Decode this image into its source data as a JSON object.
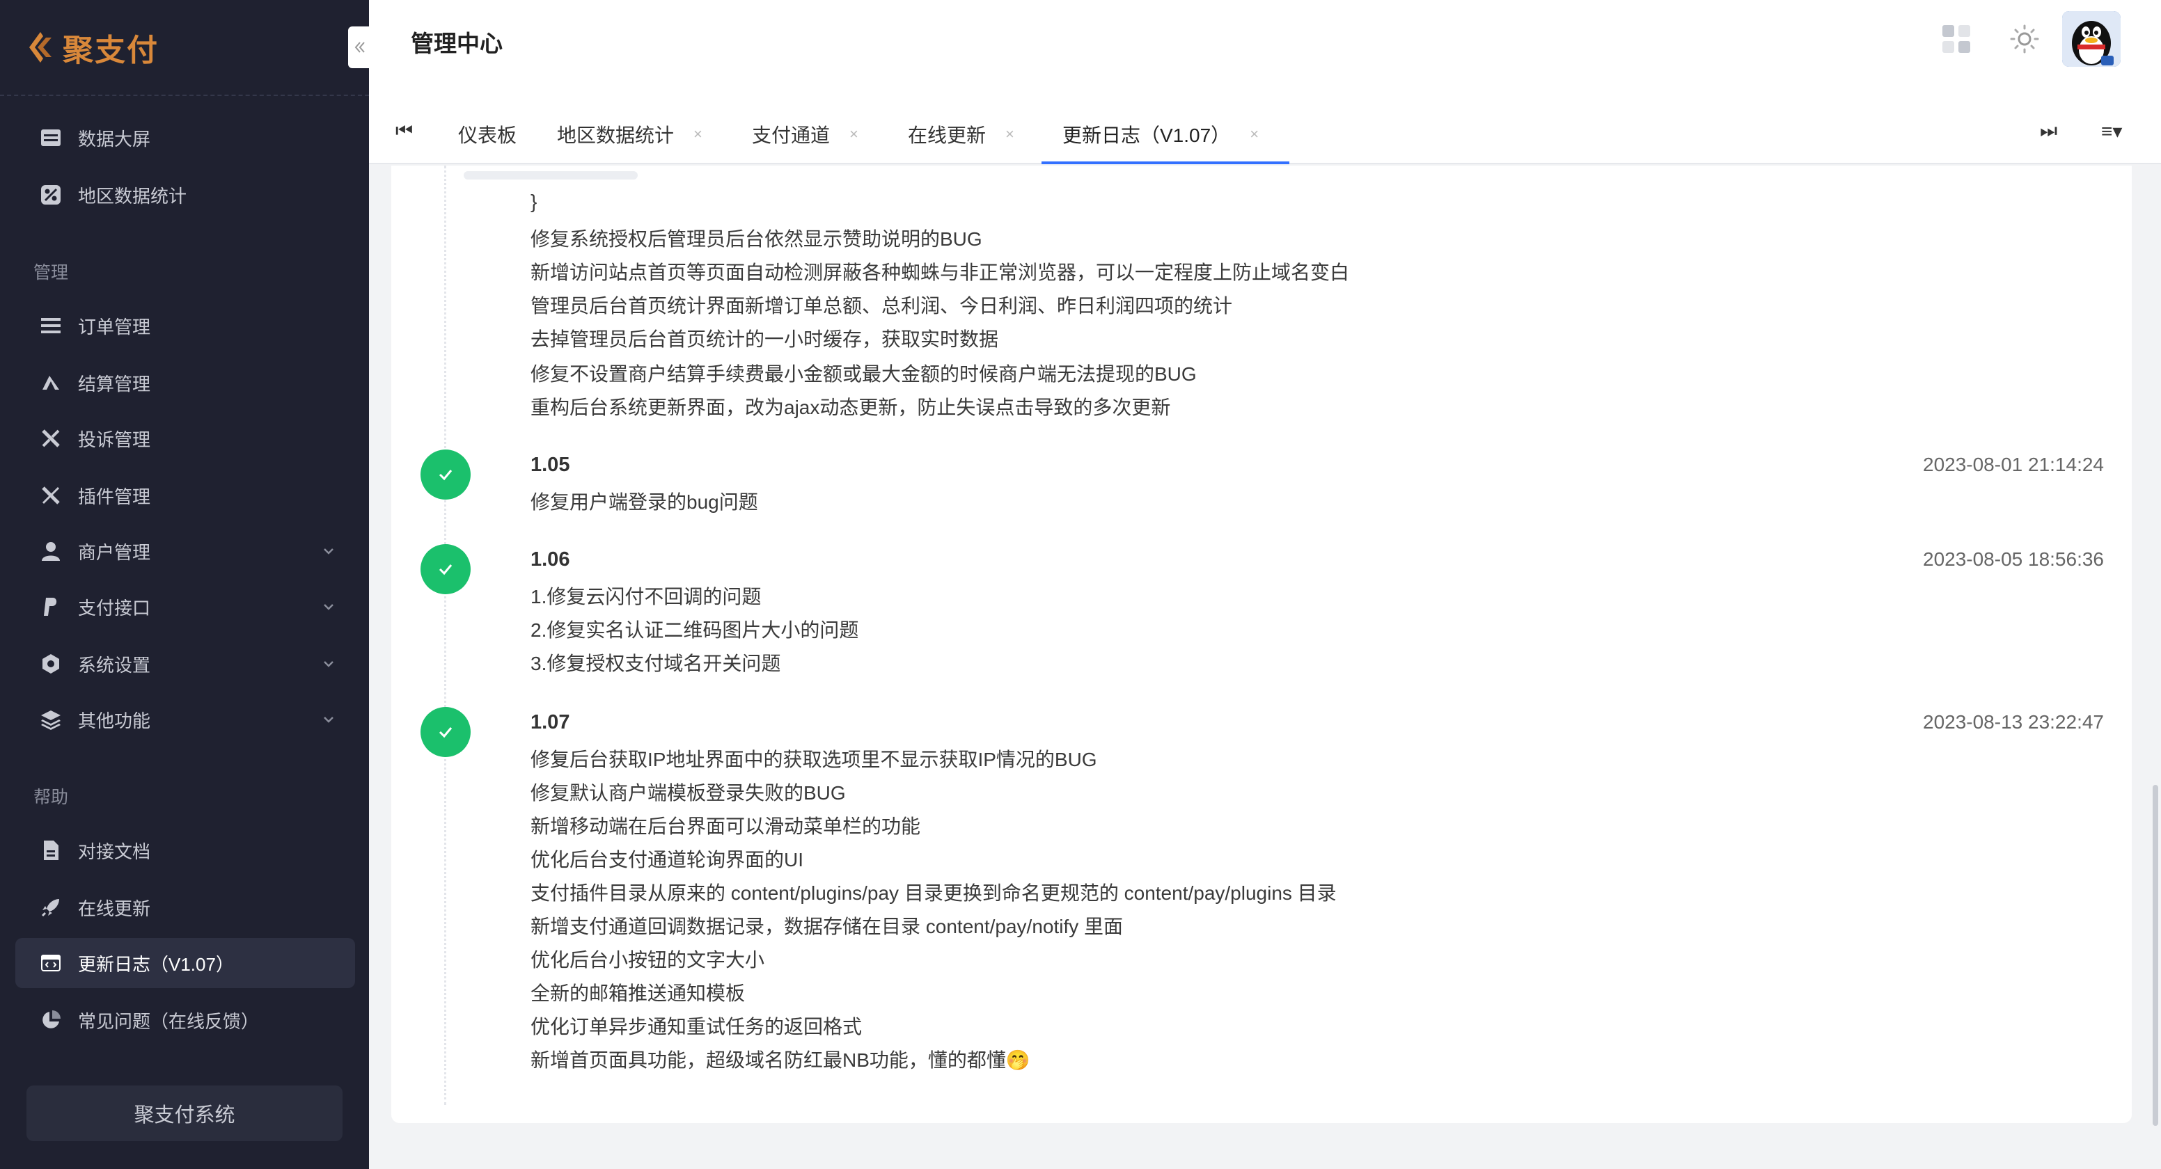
{
  "app": {
    "logo_text": "聚支付"
  },
  "sidebar": {
    "sections": {
      "manage": "管理",
      "help": "帮助"
    },
    "top_items": [
      {
        "label": "数据大屏",
        "icon": "dashboard-icon"
      },
      {
        "label": "地区数据统计",
        "icon": "percent-icon"
      }
    ],
    "manage_items": [
      {
        "label": "订单管理",
        "icon": "list-icon"
      },
      {
        "label": "结算管理",
        "icon": "settlement-icon"
      },
      {
        "label": "投诉管理",
        "icon": "tools-icon"
      },
      {
        "label": "插件管理",
        "icon": "plugin-icon"
      },
      {
        "label": "商户管理",
        "icon": "user-icon",
        "expandable": true
      },
      {
        "label": "支付接口",
        "icon": "paypal-icon",
        "expandable": true
      },
      {
        "label": "系统设置",
        "icon": "settings-icon",
        "expandable": true
      },
      {
        "label": "其他功能",
        "icon": "layers-icon",
        "expandable": true
      }
    ],
    "help_items": [
      {
        "label": "对接文档",
        "icon": "document-icon"
      },
      {
        "label": "在线更新",
        "icon": "rocket-icon"
      },
      {
        "label": "更新日志（V1.07）",
        "icon": "code-window-icon",
        "active": true
      },
      {
        "label": "常见问题（在线反馈）",
        "icon": "pie-chart-icon"
      }
    ],
    "footer_button": "聚支付系统"
  },
  "header": {
    "title": "管理中心",
    "icons": [
      "apps-grid-icon",
      "theme-sun-icon",
      "avatar-qq-penguin"
    ]
  },
  "tabs": {
    "items": [
      {
        "label": "仪表板",
        "closable": false
      },
      {
        "label": "地区数据统计",
        "closable": true
      },
      {
        "label": "支付通道",
        "closable": true
      },
      {
        "label": "在线更新",
        "closable": true
      },
      {
        "label": "更新日志（V1.07）",
        "closable": true,
        "active": true
      }
    ],
    "close_glyph": "×",
    "first_glyph": "⏮",
    "last_glyph": "⏭",
    "menu_glyph": "≡▾"
  },
  "changelog": {
    "previous_tail": [
      "}",
      "修复系统授权后管理员后台依然显示赞助说明的BUG",
      "新增访问站点首页等页面自动检测屏蔽各种蜘蛛与非正常浏览器，可以一定程度上防止域名变白",
      "管理员后台首页统计界面新增订单总额、总利润、今日利润、昨日利润四项的统计",
      "去掉管理员后台首页统计的一小时缓存，获取实时数据",
      "修复不设置商户结算手续费最小金额或最大金额的时候商户端无法提现的BUG",
      "重构后台系统更新界面，改为ajax动态更新，防止失误点击导致的多次更新"
    ],
    "entries": [
      {
        "version": "1.05",
        "date": "2023-08-01 21:14:24",
        "lines": [
          "修复用户端登录的bug问题"
        ]
      },
      {
        "version": "1.06",
        "date": "2023-08-05 18:56:36",
        "lines": [
          "1.修复云闪付不回调的问题",
          "2.修复实名认证二维码图片大小的问题",
          "3.修复授权支付域名开关问题"
        ]
      },
      {
        "version": "1.07",
        "date": "2023-08-13 23:22:47",
        "lines": [
          "修复后台获取IP地址界面中的获取选项里不显示获取IP情况的BUG",
          "修复默认商户端模板登录失败的BUG",
          "新增移动端在后台界面可以滑动菜单栏的功能",
          "优化后台支付通道轮询界面的UI",
          "支付插件目录从原来的 content/plugins/pay 目录更换到命名更规范的 content/pay/plugins 目录",
          "新增支付通道回调数据记录，数据存储在目录 content/pay/notify 里面",
          "优化后台小按钮的文字大小",
          "全新的邮箱推送通知模板",
          "优化订单异步通知重试任务的返回格式",
          "新增首页面具功能，超级域名防红最NB功能，懂的都懂🤭"
        ]
      }
    ]
  },
  "colors": {
    "sidebar_bg": "#1f2130",
    "brand": "#d9883a",
    "success": "#1bc06c",
    "tab_active": "#3370ff"
  }
}
